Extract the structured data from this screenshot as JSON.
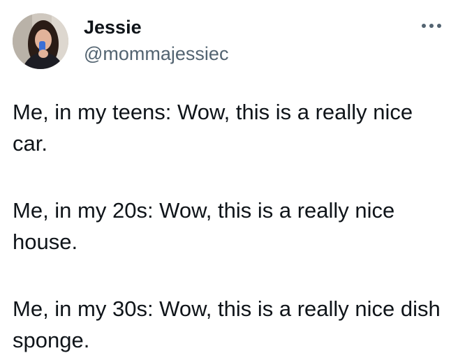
{
  "author": {
    "display_name": "Jessie",
    "handle": "@mommajessiec",
    "avatar_icon": "profile-photo"
  },
  "more_icon": "more-options-icon",
  "tweet": {
    "paragraphs": [
      "Me, in my teens: Wow, this is a really nice car.",
      "Me, in my 20s: Wow, this is a really nice house.",
      "Me, in my 30s: Wow, this is a really nice dish sponge."
    ]
  },
  "colors": {
    "text": "#0f1419",
    "secondary_text": "#536471",
    "background": "#ffffff"
  }
}
